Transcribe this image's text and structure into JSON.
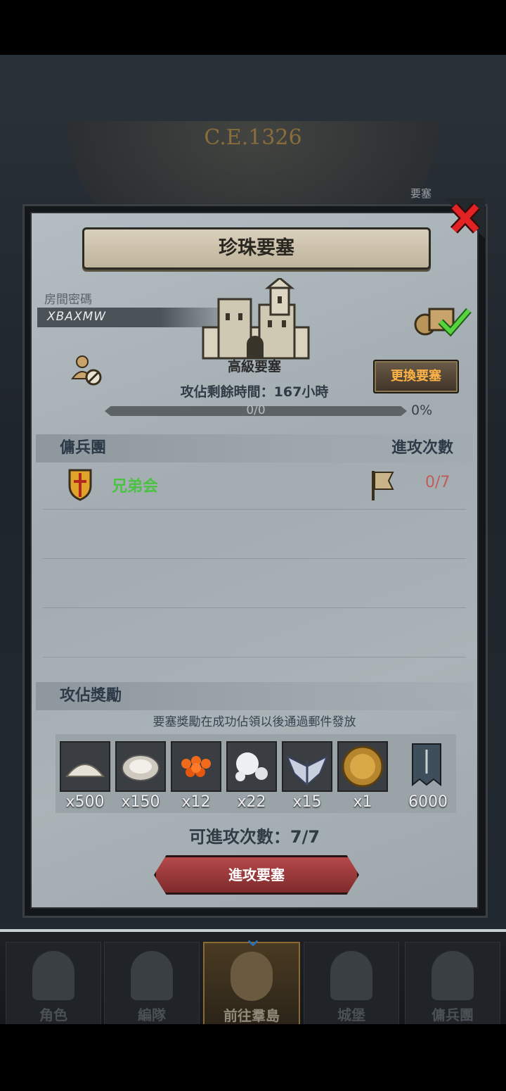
{
  "background": {
    "era_label": "C.E.1326",
    "fort_label": "要塞"
  },
  "dialog": {
    "title": "珍珠要塞",
    "room_password_label": "房間密碼",
    "room_code": "XBAXMW",
    "fort_type": "高級要塞",
    "change_fort_button": "更換要塞",
    "occupy_remaining": "攻佔剩餘時間：167小時",
    "progress": {
      "text": "0/0",
      "percent_label": "0%",
      "fill_fraction": 0
    },
    "mercenary_header": "傭兵團",
    "attack_count_header": "進攻次數",
    "guilds": [
      {
        "name": "兄弟会",
        "attacks": "0/7"
      }
    ],
    "reward_header": "攻佔獎勵",
    "reward_note": "要塞獎勵在成功佔領以後通過郵件發放",
    "rewards": [
      {
        "icon": "salt-pile-icon",
        "qty": "x500"
      },
      {
        "icon": "oyster-icon",
        "qty": "x150"
      },
      {
        "icon": "fish-roe-icon",
        "qty": "x12"
      },
      {
        "icon": "pearls-icon",
        "qty": "x22"
      },
      {
        "icon": "winged-emblem-icon",
        "qty": "x15"
      },
      {
        "icon": "knight-coin-icon",
        "qty": "x1"
      },
      {
        "icon": "guild-banner-icon",
        "qty": "6000"
      }
    ],
    "attacks_available": "可進攻次數：7/7",
    "attack_button": "進攻要塞"
  },
  "nav": {
    "items": [
      {
        "label": "角色",
        "icon": "knight-icon"
      },
      {
        "label": "編隊",
        "icon": "helmet-icon"
      },
      {
        "label": "前往羣島",
        "icon": "compass-island-icon"
      },
      {
        "label": "城堡",
        "icon": "castle-icon"
      },
      {
        "label": "傭兵團",
        "icon": "mercenary-icon"
      }
    ]
  },
  "colors": {
    "accent_orange": "#ffb347",
    "guild_green": "#4cc242",
    "attack_red": "#c25b5b",
    "button_red": "#9e3a3b"
  }
}
